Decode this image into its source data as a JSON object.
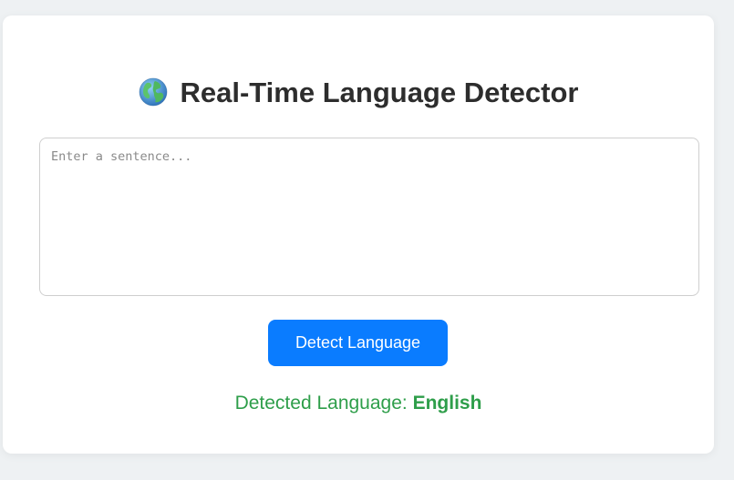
{
  "header": {
    "icon": "globe-icon",
    "title": "Real-Time Language Detector"
  },
  "input": {
    "placeholder": "Enter a sentence...",
    "value": ""
  },
  "button": {
    "label": "Detect Language"
  },
  "result": {
    "label": "Detected Language:",
    "language": "English"
  },
  "colors": {
    "accent": "#0a7cff",
    "success": "#2e9e4a",
    "title": "#2d2d2d",
    "background": "#eef1f3"
  }
}
